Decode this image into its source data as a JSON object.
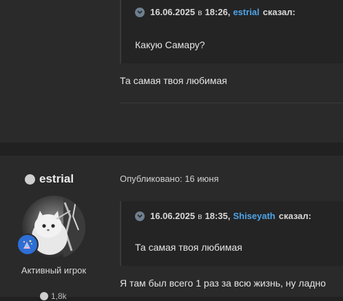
{
  "post_top": {
    "quote": {
      "date": "16.06.2025",
      "at": "в",
      "time": "18:26,",
      "author": "estrial",
      "said": "сказал:",
      "body": "Какую Самару?"
    },
    "message": "Та самая твоя любимая"
  },
  "post_bottom": {
    "user": {
      "name": "estrial",
      "role": "Активный игрок",
      "stat_partial": "1,8k"
    },
    "published": "Опубликовано: 16 июня",
    "quote": {
      "date": "16.06.2025",
      "at": "в",
      "time": "18:35,",
      "author": "Shiseyath",
      "said": "сказал:",
      "body": "Та самая твоя любимая"
    },
    "message": "Я там был всего 1 раз за всю жизнь, ну ладно"
  },
  "colors": {
    "page_bg": "#212121",
    "post_bg": "#2a2a2a",
    "quote_bg": "#242424",
    "link": "#4ea4e8",
    "badge": "#2d6fd6"
  }
}
